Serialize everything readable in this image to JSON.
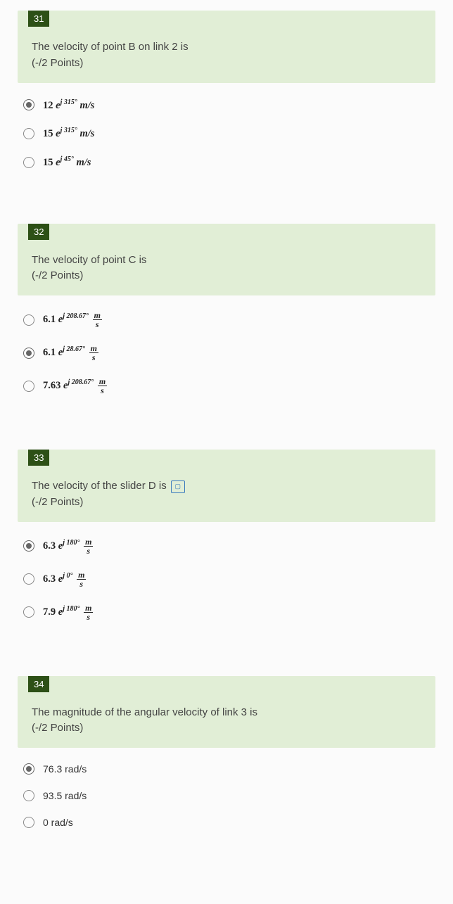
{
  "questions": [
    {
      "number": "31",
      "text": "The velocity of point B on link 2 is",
      "points": "(-/2 Points)",
      "hasIcon": false,
      "options": [
        {
          "coef": "12",
          "exp": "j 315°",
          "unit_style": "italic-ms",
          "unit": "m/s",
          "selected": true
        },
        {
          "coef": "15",
          "exp": "j 315°",
          "unit_style": "italic-ms",
          "unit": "m/s",
          "selected": false
        },
        {
          "coef": "15",
          "exp": "j 45°",
          "unit_style": "italic-ms",
          "unit": "m/s",
          "selected": false
        }
      ]
    },
    {
      "number": "32",
      "text": "The velocity of point C is",
      "points": "(-/2 Points)",
      "hasIcon": false,
      "options": [
        {
          "coef": "6.1",
          "exp": "j 208.67°",
          "unit_style": "frac",
          "unit": "m/s",
          "selected": false
        },
        {
          "coef": "6.1",
          "exp": "j 28.67°",
          "unit_style": "frac",
          "unit": "m/s",
          "selected": true
        },
        {
          "coef": "7.63",
          "exp": "j 208.67°",
          "unit_style": "frac",
          "unit": "m/s",
          "selected": false
        }
      ]
    },
    {
      "number": "33",
      "text": "The velocity of the slider D is",
      "points": "(-/2 Points)",
      "hasIcon": true,
      "options": [
        {
          "coef": "6.3",
          "exp": "j 180°",
          "unit_style": "frac",
          "unit": "m/s",
          "selected": true
        },
        {
          "coef": "6.3",
          "exp": "j 0°",
          "unit_style": "frac",
          "unit": "m/s",
          "selected": false
        },
        {
          "coef": "7.9",
          "exp": "j 180°",
          "unit_style": "frac",
          "unit": "m/s",
          "selected": false
        }
      ]
    },
    {
      "number": "34",
      "text": "The magnitude of the angular velocity of link 3 is",
      "points": "(-/2 Points)",
      "hasIcon": false,
      "options": [
        {
          "plain": "76.3 rad/s",
          "selected": true
        },
        {
          "plain": "93.5 rad/s",
          "selected": false
        },
        {
          "plain": "0 rad/s",
          "selected": false
        }
      ]
    }
  ]
}
